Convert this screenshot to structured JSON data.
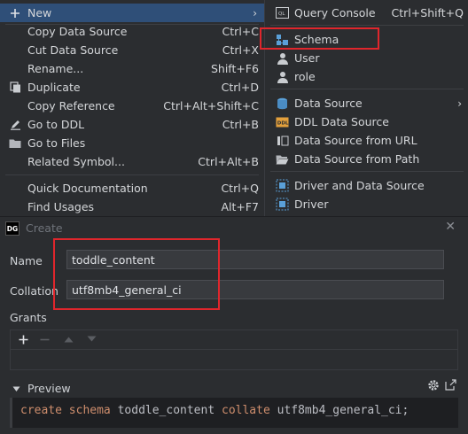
{
  "context_menu": {
    "items": [
      {
        "label": "New",
        "shortcut": "",
        "icon": "plus-icon",
        "submenu": true
      },
      {
        "label": "Copy Data Source",
        "shortcut": "Ctrl+C"
      },
      {
        "label": "Cut Data Source",
        "shortcut": "Ctrl+X"
      },
      {
        "label": "Rename...",
        "shortcut": "Shift+F6"
      },
      {
        "label": "Duplicate",
        "shortcut": "Ctrl+D",
        "icon": "duplicate-icon"
      },
      {
        "label": "Copy Reference",
        "shortcut": "Ctrl+Alt+Shift+C"
      },
      {
        "label": "Go to DDL",
        "shortcut": "Ctrl+B",
        "icon": "pencil-icon"
      },
      {
        "label": "Go to Files",
        "shortcut": "",
        "icon": "folder-icon"
      },
      {
        "label": "Related Symbol...",
        "shortcut": "Ctrl+Alt+B"
      },
      {
        "label": "Quick Documentation",
        "shortcut": "Ctrl+Q"
      },
      {
        "label": "Find Usages",
        "shortcut": "Alt+F7"
      }
    ]
  },
  "submenu": {
    "items": [
      {
        "label": "Query Console",
        "shortcut": "Ctrl+Shift+Q",
        "icon": "query-console-icon"
      },
      {
        "label": "Schema",
        "shortcut": "",
        "icon": "schema-icon"
      },
      {
        "label": "User",
        "shortcut": "",
        "icon": "user-icon"
      },
      {
        "label": "role",
        "shortcut": "",
        "icon": "role-icon"
      },
      {
        "label": "Data Source",
        "shortcut": "",
        "icon": "database-icon",
        "submenu": true
      },
      {
        "label": "DDL Data Source",
        "shortcut": "",
        "icon": "ddl-icon"
      },
      {
        "label": "Data Source from URL",
        "shortcut": "",
        "icon": "url-icon"
      },
      {
        "label": "Data Source from Path",
        "shortcut": "",
        "icon": "folder-open-icon"
      },
      {
        "label": "Driver and Data Source",
        "shortcut": "",
        "icon": "driver-datasource-icon"
      },
      {
        "label": "Driver",
        "shortcut": "",
        "icon": "driver-icon"
      }
    ]
  },
  "dialog": {
    "logo": "DG",
    "title": "Create",
    "name_label": "Name",
    "name_value": "toddle_content",
    "collation_label": "Collation",
    "collation_value": "utf8mb4_general_ci",
    "grants_label": "Grants",
    "preview_label": "Preview",
    "sql": {
      "kw1": "create",
      "kw2": "schema",
      "name": "toddle_content",
      "kw3": "collate",
      "collation": "utf8mb4_general_ci;"
    }
  },
  "colors": {
    "accent_highlight": "#2f4f78",
    "annotation_red": "#e0262c",
    "keyword": "#cf8e6d"
  }
}
